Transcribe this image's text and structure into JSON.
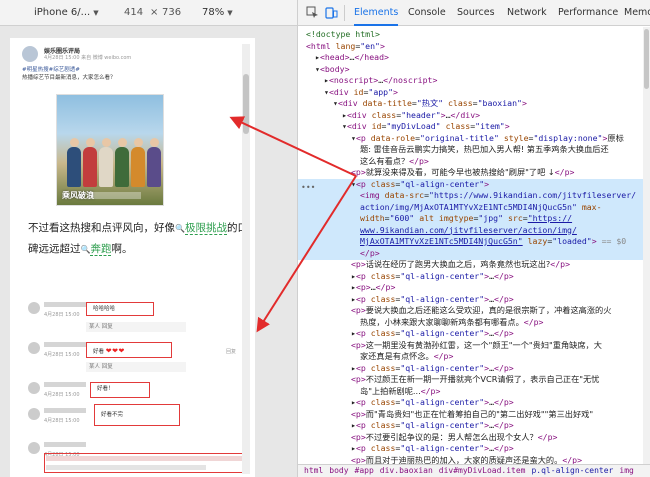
{
  "device_toolbar": {
    "device": "iPhone 6/...",
    "width": "414",
    "x": "×",
    "height": "736",
    "zoom": "78%"
  },
  "post": {
    "author": "娱乐圈乐评局",
    "meta": "4月28日 15:00 来自 微博 weibo.com",
    "body_line1": "#明星热搜#综艺剧透#",
    "body_line2": "热播综艺节目最新消息，大家怎么看？"
  },
  "movie": {
    "logo": "乘风破浪"
  },
  "main_text": {
    "part1": "不过看这热搜和点评风向，好像",
    "hl1": "极限挑战",
    "part2": "的口碑远远超过",
    "hl2": "奔跑",
    "part3": "啊。",
    "icon": "🔍"
  },
  "comments": [
    {
      "time": "4月28日 15:00",
      "reply": "哈哈哈哈",
      "hearts": ""
    },
    {
      "time": "",
      "reply": "某人 回复",
      "hearts": ""
    },
    {
      "time": "4月28日 15:00",
      "reply": "好看",
      "hearts": "❤❤❤",
      "like": "回复"
    },
    {
      "time": "",
      "reply": "某人 回复",
      "hearts": ""
    },
    {
      "time": "4月28日 15:00",
      "reply": "好看！",
      "hearts": ""
    },
    {
      "time": "4月28日 15:00",
      "reply": "好看不完",
      "hearts": ""
    },
    {
      "time": "4月28日 15:00",
      "reply": "",
      "hearts": ""
    }
  ],
  "devtools": {
    "tabs": [
      "Elements",
      "Console",
      "Sources",
      "Network",
      "Performance",
      "Memo"
    ],
    "lines": [
      {
        "i": 0,
        "h": "<span class=\"cm\">&lt;!doctype html&gt;</span>"
      },
      {
        "i": 0,
        "h": "<span class=\"tg\">&lt;html</span> <span class=\"at\">lang</span>=<span class=\"av2\">\"en\"</span><span class=\"tg\">&gt;</span>"
      },
      {
        "i": 1,
        "h": "▸<span class=\"tg\">&lt;head&gt;</span>…<span class=\"tg\">&lt;/head&gt;</span>"
      },
      {
        "i": 1,
        "h": "▾<span class=\"tg\">&lt;body&gt;</span>"
      },
      {
        "i": 2,
        "h": "▸<span class=\"tg\">&lt;noscript&gt;</span>…<span class=\"tg\">&lt;/noscript&gt;</span>"
      },
      {
        "i": 2,
        "h": "▾<span class=\"tg\">&lt;div</span> <span class=\"at\">id</span>=<span class=\"av2\">\"app\"</span><span class=\"tg\">&gt;</span>"
      },
      {
        "i": 3,
        "h": "▾<span class=\"tg\">&lt;div</span> <span class=\"at\">data-title</span>=<span class=\"av2\">\"热文\"</span> <span class=\"at\">class</span>=<span class=\"av2\">\"baoxian\"</span><span class=\"tg\">&gt;</span>"
      },
      {
        "i": 4,
        "h": "▸<span class=\"tg\">&lt;div</span> <span class=\"at\">class</span>=<span class=\"av2\">\"header\"</span><span class=\"tg\">&gt;</span>…<span class=\"tg\">&lt;/div&gt;</span>"
      },
      {
        "i": 4,
        "h": "▾<span class=\"tg\">&lt;div</span> <span class=\"at\">id</span>=<span class=\"av2\">\"myDivLoad\"</span> <span class=\"at\">class</span>=<span class=\"av2\">\"item\"</span><span class=\"tg\">&gt;</span>"
      },
      {
        "i": 5,
        "h": "▾<span class=\"tg\">&lt;p</span> <span class=\"at\">data-role</span>=<span class=\"av2\">\"original-title\"</span> <span class=\"at\">style</span>=<span class=\"av2\">\"display:none\"</span><span class=\"tg\">&gt;</span>原标"
      },
      {
        "i": 6,
        "h": "<span class=\"tx\">题: 雷佳音岳云鹏实力搞笑，热巴加入男人帮! 第五季鸡条大换血后还</span>"
      },
      {
        "i": 6,
        "h": "<span class=\"tx\">这么有看点？</span><span class=\"tg\">&lt;/p&gt;</span>"
      },
      {
        "i": 5,
        "h": "<span class=\"tg\">&lt;p&gt;</span><span class=\"tx\">就算没来得及看，可能今早也被热搜给\"刷屏\"了吧 ↓</span><span class=\"tg\">&lt;/p&gt;</span>"
      },
      {
        "i": 5,
        "h": "▾<span class=\"tg\">&lt;p</span> <span class=\"at\">class</span>=<span class=\"av2\">\"ql-align-center\"</span><span class=\"tg\">&gt;</span>"
      },
      {
        "i": 6,
        "h": "<span class=\"tg\">&lt;img</span> <span class=\"at\">data-src</span>=<span class=\"av2\">\"https://www.9ikandian.com/jitvfileserver/</span>"
      },
      {
        "i": 6,
        "h": "<span class=\"av2\">action/img/MjAxOTA1MTYvXzE1NTc5MDI4NjQucG5n\"</span> <span class=\"at\">max-</span>"
      },
      {
        "i": 6,
        "h": "<span class=\"at\">width</span>=<span class=\"av2\">\"600\"</span> <span class=\"at\">alt</span> <span class=\"at\">imgtype</span>=<span class=\"av2\">\"jpg\"</span> <span class=\"at\">src</span>=<span class=\"lk\">\"https://</span>"
      },
      {
        "i": 6,
        "h": "<span class=\"lk\">www.9ikandian.com/jitvfileserver/action/img/</span>"
      },
      {
        "i": 6,
        "h": "<span class=\"lk\">MjAxOTA1MTYvXzE1NTc5MDI4NjQucG5n\"</span> <span class=\"at\">lazy</span>=<span class=\"av2\">\"loaded\"</span><span class=\"tg\">&gt;</span> <span class=\"tw\">== $0</span>"
      },
      {
        "i": 6,
        "h": "<span class=\"tg\">&lt;/p&gt;</span>"
      },
      {
        "i": 5,
        "h": "<span class=\"tg\">&lt;p&gt;</span><span class=\"tx\">话说在经历了跑男大换血之后，鸡条竟然也玩这出?</span><span class=\"tg\">&lt;/p&gt;</span>"
      },
      {
        "i": 5,
        "h": "▸<span class=\"tg\">&lt;p</span> <span class=\"at\">class</span>=<span class=\"av2\">\"ql-align-center\"</span><span class=\"tg\">&gt;</span>…<span class=\"tg\">&lt;/p&gt;</span>"
      },
      {
        "i": 5,
        "h": "▸<span class=\"tg\">&lt;p&gt;</span>…<span class=\"tg\">&lt;/p&gt;</span>"
      },
      {
        "i": 5,
        "h": "▸<span class=\"tg\">&lt;p</span> <span class=\"at\">class</span>=<span class=\"av2\">\"ql-align-center\"</span><span class=\"tg\">&gt;</span>…<span class=\"tg\">&lt;/p&gt;</span>"
      },
      {
        "i": 5,
        "h": "<span class=\"tg\">&lt;p&gt;</span><span class=\"tx\">要说大换血之后还能这么受欢迎，真的是很宗斯了，冲着这高涨的火</span>"
      },
      {
        "i": 6,
        "h": "<span class=\"tx\">热度，小林来跟大家聊聊新鸡条都有哪看点。</span><span class=\"tg\">&lt;/p&gt;</span>"
      },
      {
        "i": 5,
        "h": "▸<span class=\"tg\">&lt;p</span> <span class=\"at\">class</span>=<span class=\"av2\">\"ql-align-center\"</span><span class=\"tg\">&gt;</span>…<span class=\"tg\">&lt;/p&gt;</span>"
      },
      {
        "i": 5,
        "h": "<span class=\"tg\">&lt;p&gt;</span><span class=\"tx\">这一期里没有黄渤孙红雷，这一个\"颜王\"一个\"贵妇\"重角缺席，大</span>"
      },
      {
        "i": 6,
        "h": "<span class=\"tx\">家还真是有点怀念。</span><span class=\"tg\">&lt;/p&gt;</span>"
      },
      {
        "i": 5,
        "h": "▸<span class=\"tg\">&lt;p</span> <span class=\"at\">class</span>=<span class=\"av2\">\"ql-align-center\"</span><span class=\"tg\">&gt;</span>…<span class=\"tg\">&lt;/p&gt;</span>"
      },
      {
        "i": 5,
        "h": "<span class=\"tg\">&lt;p&gt;</span><span class=\"tx\">不过颜王在新一期一开播就亮个VCR请假了，表示自己正在\"无忧</span>"
      },
      {
        "i": 6,
        "h": "<span class=\"tx\">岛\"上拍新剧呢...</span><span class=\"tg\">&lt;/p&gt;</span>"
      },
      {
        "i": 5,
        "h": "▸<span class=\"tg\">&lt;p</span> <span class=\"at\">class</span>=<span class=\"av2\">\"ql-align-center\"</span><span class=\"tg\">&gt;</span>…<span class=\"tg\">&lt;/p&gt;</span>"
      },
      {
        "i": 5,
        "h": "<span class=\"tg\">&lt;p&gt;</span><span class=\"tx\">而\"青岛贵妇\"也正在忙着筹拍自己的\"第二出好戏\"\"第三出好戏\"</span>"
      },
      {
        "i": 5,
        "h": "▸<span class=\"tg\">&lt;p</span> <span class=\"at\">class</span>=<span class=\"av2\">\"ql-align-center\"</span><span class=\"tg\">&gt;</span>…<span class=\"tg\">&lt;/p&gt;</span>"
      },
      {
        "i": 5,
        "h": "<span class=\"tg\">&lt;p&gt;</span><span class=\"tx\">不过要引起争议的是：男人帮怎么出现个女人？</span><span class=\"tg\">&lt;/p&gt;</span>"
      },
      {
        "i": 5,
        "h": "▸<span class=\"tg\">&lt;p</span> <span class=\"at\">class</span>=<span class=\"av2\">\"ql-align-center\"</span><span class=\"tg\">&gt;</span>…<span class=\"tg\">&lt;/p&gt;</span>"
      },
      {
        "i": 5,
        "h": "<span class=\"tg\">&lt;p&gt;</span><span class=\"tx\">而且对于迪丽热巴的加入，大家的质疑声还是蛮大的。</span><span class=\"tg\">&lt;/p&gt;</span>"
      }
    ],
    "breadcrumbs": [
      "html",
      "body",
      "#app",
      "div.baoxian",
      "div#myDivLoad.item",
      "p.ql-align-center",
      "img"
    ]
  }
}
